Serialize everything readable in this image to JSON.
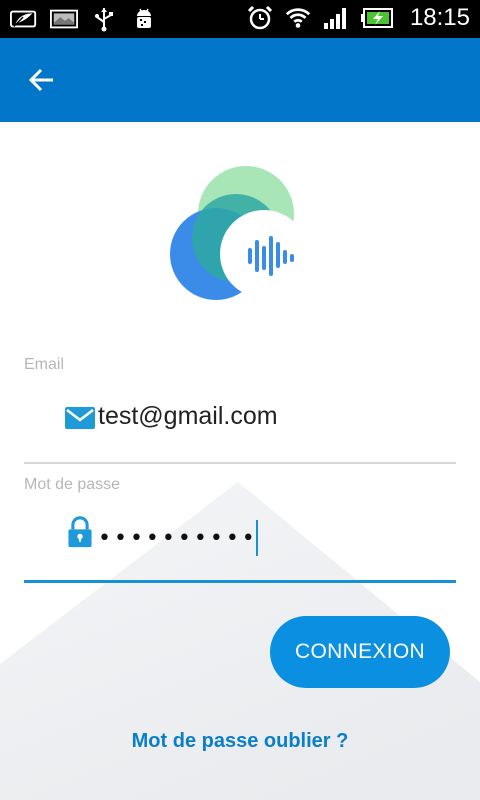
{
  "status_bar": {
    "time": "18:15",
    "left_icons": [
      "leaf-icon",
      "image-icon",
      "usb-icon",
      "android-icon"
    ],
    "right_icons": [
      "alarm-icon",
      "wifi-icon",
      "signal-icon",
      "battery-charging-icon"
    ]
  },
  "app_bar": {
    "back_icon": "arrow-left-icon",
    "color": "#0277c9"
  },
  "logo": {
    "icon": "voice-wave-logo"
  },
  "form": {
    "email": {
      "label": "Email",
      "value": "test@gmail.com",
      "icon": "envelope-icon"
    },
    "password": {
      "label": "Mot de passe",
      "value": "••••••••••",
      "icon": "lock-icon"
    }
  },
  "actions": {
    "connect_label": "CONNEXION",
    "forgot_label": "Mot de passe oublier ?"
  },
  "colors": {
    "primary": "#0277c9",
    "button": "#0b8fe0",
    "accent_line": "#1a8fd6",
    "label": "#b6b6b6"
  }
}
